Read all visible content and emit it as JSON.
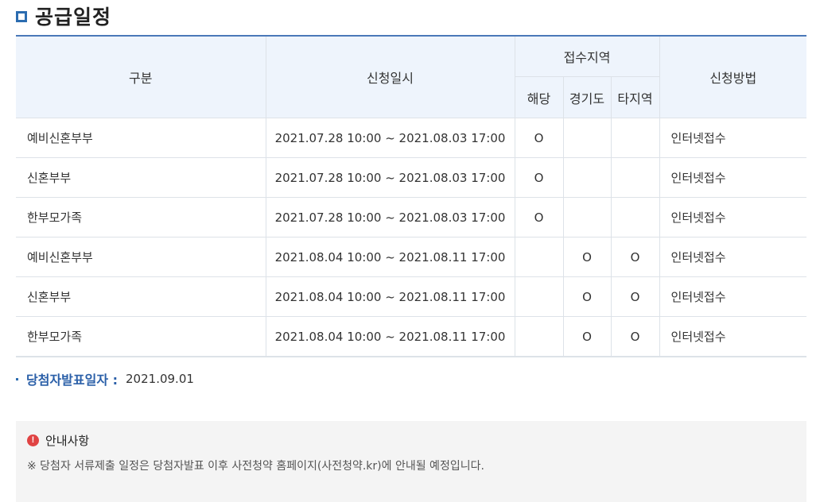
{
  "title": "공급일정",
  "table": {
    "headers": {
      "type": "구분",
      "period": "신청일시",
      "region_group": "접수지역",
      "region_local": "해당",
      "region_gyeonggi": "경기도",
      "region_other": "타지역",
      "method": "신청방법"
    },
    "rows": [
      {
        "type": "예비신혼부부",
        "period": "2021.07.28 10:00 ~ 2021.08.03 17:00",
        "local": "O",
        "gyeonggi": "",
        "other": "",
        "method": "인터넷접수"
      },
      {
        "type": "신혼부부",
        "period": "2021.07.28 10:00 ~ 2021.08.03 17:00",
        "local": "O",
        "gyeonggi": "",
        "other": "",
        "method": "인터넷접수"
      },
      {
        "type": "한부모가족",
        "period": "2021.07.28 10:00 ~ 2021.08.03 17:00",
        "local": "O",
        "gyeonggi": "",
        "other": "",
        "method": "인터넷접수"
      },
      {
        "type": "예비신혼부부",
        "period": "2021.08.04 10:00 ~ 2021.08.11 17:00",
        "local": "",
        "gyeonggi": "O",
        "other": "O",
        "method": "인터넷접수"
      },
      {
        "type": "신혼부부",
        "period": "2021.08.04 10:00 ~ 2021.08.11 17:00",
        "local": "",
        "gyeonggi": "O",
        "other": "O",
        "method": "인터넷접수"
      },
      {
        "type": "한부모가족",
        "period": "2021.08.04 10:00 ~ 2021.08.11 17:00",
        "local": "",
        "gyeonggi": "O",
        "other": "O",
        "method": "인터넷접수"
      }
    ]
  },
  "announcement": {
    "label": "당첨자발표일자 :",
    "date": "2021.09.01"
  },
  "notice": {
    "icon": "alert-icon",
    "icon_glyph": "!",
    "title": "안내사항",
    "text": "※ 당첨자 서류제출 일정은 당첨자발표 이후 사전청약 홈페이지(사전청약.kr)에 안내될 예정입니다."
  },
  "colors": {
    "accent": "#2b6cb0",
    "header_bg": "#eef4fc",
    "alert": "#e04343",
    "notice_bg": "#f4f4f4"
  }
}
